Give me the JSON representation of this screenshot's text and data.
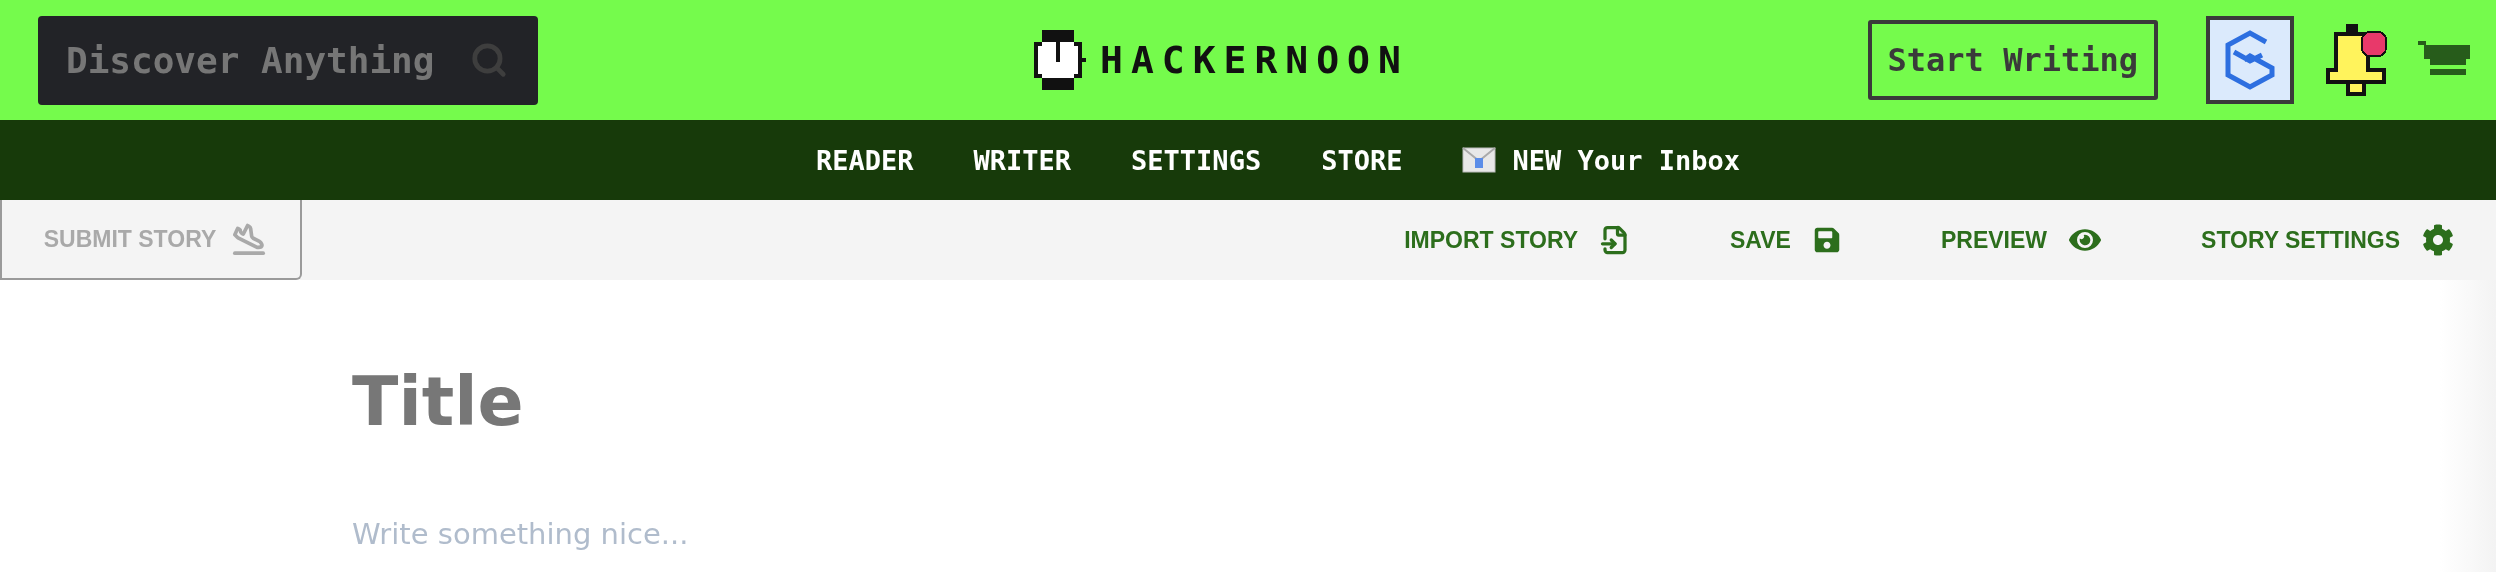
{
  "header": {
    "search": {
      "placeholder": "Discover Anything"
    },
    "logo": {
      "text": "HACKERNOON"
    },
    "start_writing": "Start Writing",
    "notifications": {
      "unread": true
    }
  },
  "nav": {
    "items": [
      {
        "label": "READER",
        "kind": "link"
      },
      {
        "label": "WRITER",
        "kind": "link"
      },
      {
        "label": "SETTINGS",
        "kind": "link"
      },
      {
        "label": "STORE",
        "kind": "link"
      },
      {
        "label": "NEW Your Inbox",
        "kind": "inbox"
      }
    ]
  },
  "toolbar": {
    "submit": {
      "label": "SUBMIT STORY",
      "disabled": true
    },
    "actions": [
      {
        "label": "IMPORT STORY",
        "kind": "import"
      },
      {
        "label": "SAVE",
        "kind": "save"
      },
      {
        "label": "PREVIEW",
        "kind": "preview"
      },
      {
        "label": "STORY SETTINGS",
        "kind": "settings"
      }
    ]
  },
  "editor": {
    "title_placeholder": "Title",
    "body_placeholder": "Write something nice..."
  }
}
